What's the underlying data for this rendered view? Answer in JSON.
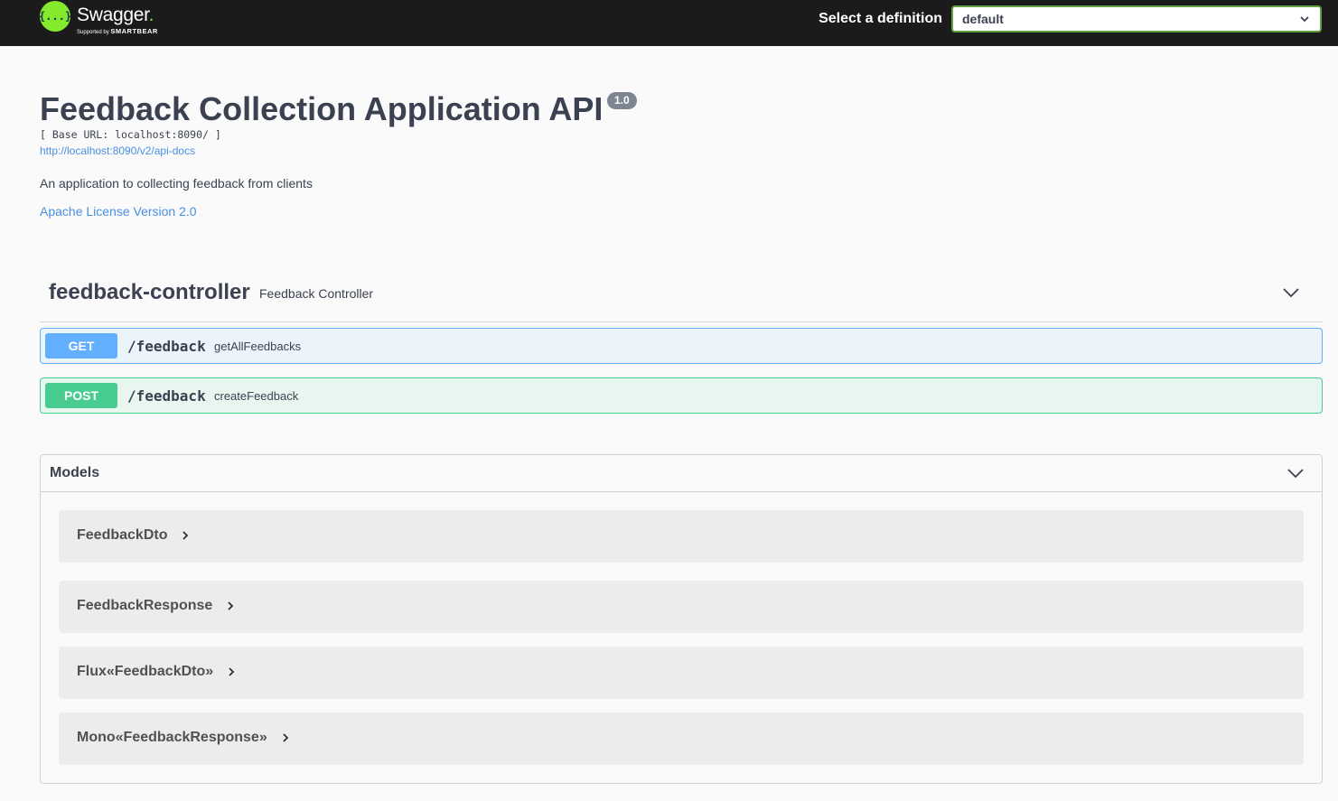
{
  "topbar": {
    "logo_brand": "Swagger",
    "logo_dot": ".",
    "logo_supported": "Supported by",
    "logo_company": "SMARTBEAR",
    "select_label": "Select a definition",
    "selected_definition": "default",
    "icons": {
      "logo": "swagger-logo-icon",
      "dropdown": "chevron-down-icon"
    }
  },
  "info": {
    "title": "Feedback Collection Application API",
    "version": "1.0",
    "base_url": "[ Base URL: localhost:8090/ ]",
    "api_docs_url": "http://localhost:8090/v2/api-docs",
    "description": "An application to collecting feedback from clients",
    "license": "Apache License Version 2.0"
  },
  "tag": {
    "name": "feedback-controller",
    "description": "Feedback Controller"
  },
  "operations": [
    {
      "method": "GET",
      "path": "/feedback",
      "summary": "getAllFeedbacks"
    },
    {
      "method": "POST",
      "path": "/feedback",
      "summary": "createFeedback"
    }
  ],
  "models": {
    "title": "Models",
    "items": [
      {
        "name": "FeedbackDto"
      },
      {
        "name": "FeedbackResponse"
      },
      {
        "name": "Flux«FeedbackDto»"
      },
      {
        "name": "Mono«FeedbackResponse»"
      }
    ]
  },
  "colors": {
    "topbar_bg": "#1b1b1b",
    "get": "#61affe",
    "post": "#49cc90",
    "link": "#4990e2",
    "accent_green": "#85ea2d"
  }
}
